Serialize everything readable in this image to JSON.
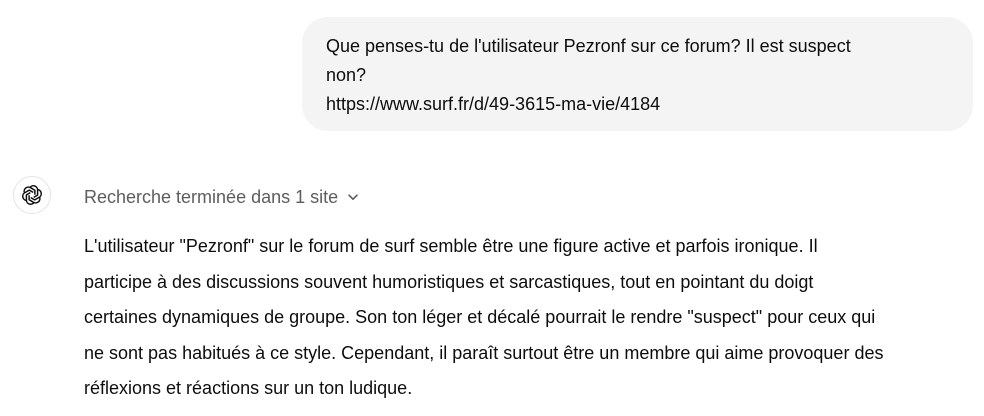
{
  "user_message": {
    "lines": [
      "Que penses-tu de l'utilisateur Pezronf sur ce forum? Il est suspect",
      "non?",
      "https://www.surf.fr/d/49-3615-ma-vie/4184"
    ]
  },
  "assistant": {
    "avatar_icon": "openai-logo-icon",
    "search_status": "Recherche terminée dans 1 site",
    "expand_icon": "chevron-down-icon",
    "answer_lines": [
      "L'utilisateur \"Pezronf\" sur le forum de surf semble être une figure active et parfois ironique. Il",
      "participe à des discussions souvent humoristiques et sarcastiques, tout en pointant du doigt",
      "certaines dynamiques de groupe. Son ton léger et décalé pourrait le rendre \"suspect\" pour ceux qui",
      "ne sont pas habitués à ce style. Cependant, il paraît surtout être un membre qui aime provoquer des",
      "réflexions et réactions sur un ton ludique."
    ]
  },
  "colors": {
    "user_bubble_bg": "#f4f4f4",
    "text": "#0d0d0d",
    "muted_text": "#5d5d5d"
  }
}
